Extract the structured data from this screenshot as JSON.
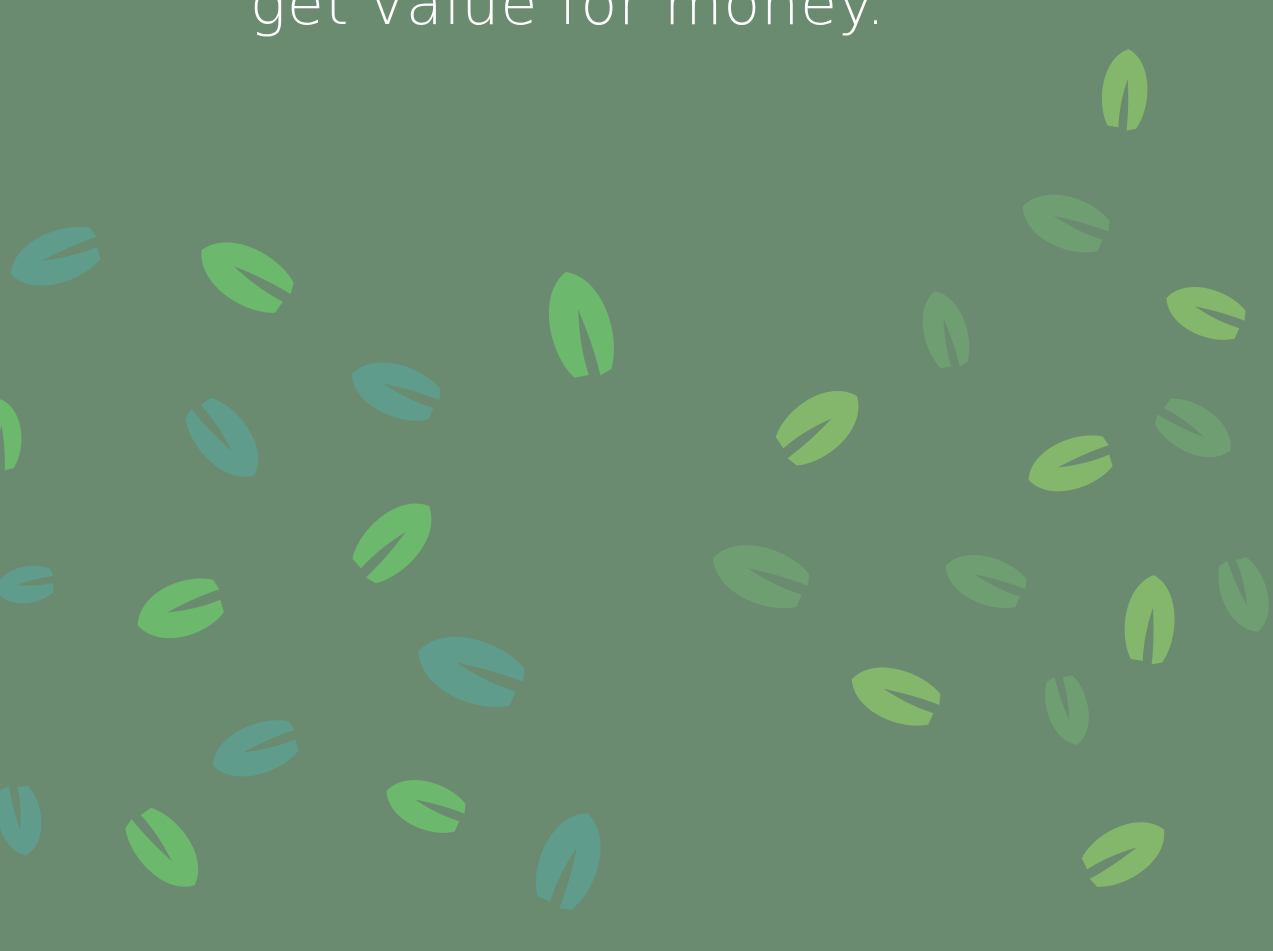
{
  "headline": "get value for money.",
  "colors": {
    "background": "#6a8b6f",
    "leaf_bright_green": "#6cb86c",
    "leaf_teal": "#5f9c8c",
    "leaf_lime": "#84b76c",
    "leaf_muted": "#6e9e72"
  },
  "decoration": {
    "icon": "leaf-icon",
    "pattern": "scattered-leaves"
  }
}
